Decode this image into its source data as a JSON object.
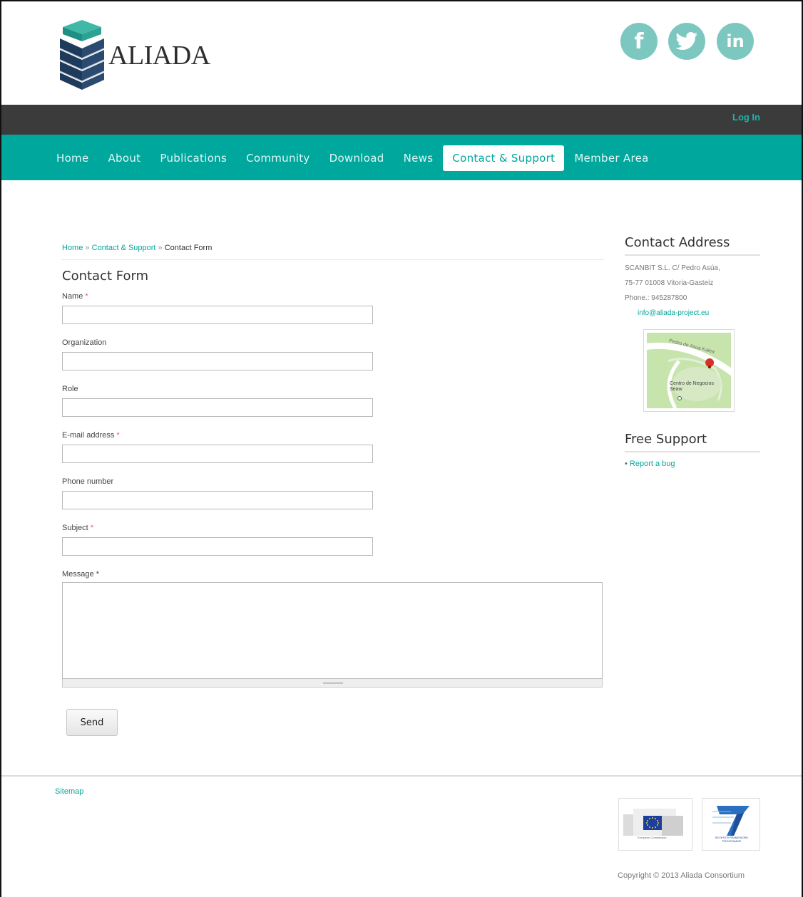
{
  "header": {
    "logo_text": "ALIADA",
    "social": {
      "facebook": "f",
      "linkedin": "in"
    }
  },
  "topbar": {
    "login_label": "Log In"
  },
  "nav": {
    "items": [
      {
        "label": "Home"
      },
      {
        "label": "About"
      },
      {
        "label": "Publications"
      },
      {
        "label": "Community"
      },
      {
        "label": "Download"
      },
      {
        "label": "News"
      },
      {
        "label": "Contact & Support",
        "active": true
      },
      {
        "label": "Member Area"
      }
    ]
  },
  "breadcrumb": {
    "home": "Home",
    "sep": "»",
    "section": "Contact & Support",
    "current": "Contact Form"
  },
  "page_title": "Contact Form",
  "form": {
    "required_mark": "*",
    "fields": {
      "name": "Name",
      "organization": "Organization",
      "role": "Role",
      "email": "E-mail address",
      "phone": "Phone number",
      "subject": "Subject",
      "message": "Message"
    },
    "send_label": "Send"
  },
  "sidebar": {
    "contact_title": "Contact Address",
    "address_line1": "SCANBIT S.L. C/ Pedro Asúa,",
    "address_line2": "75-77 01008 Vitoria-Gasteiz",
    "phone": "Phone.: 945287800",
    "email": "info@aliada-project.eu",
    "map": {
      "street": "Pedro de Asua Kalea",
      "place": "Centro de Negocios Seaw"
    },
    "support_title": "Free Support",
    "support_link": "Report a bug"
  },
  "footer": {
    "sitemap": "Sitemap",
    "ec_label": "European Commission",
    "fp7_label": "SEVENTH FRAMEWORK PROGRAMME",
    "copyright": "Copyright © 2013 Aliada Consortium"
  },
  "colors": {
    "teal": "#00a79d",
    "dark_bar": "#3b3b3b",
    "social": "#7dc7c1"
  }
}
